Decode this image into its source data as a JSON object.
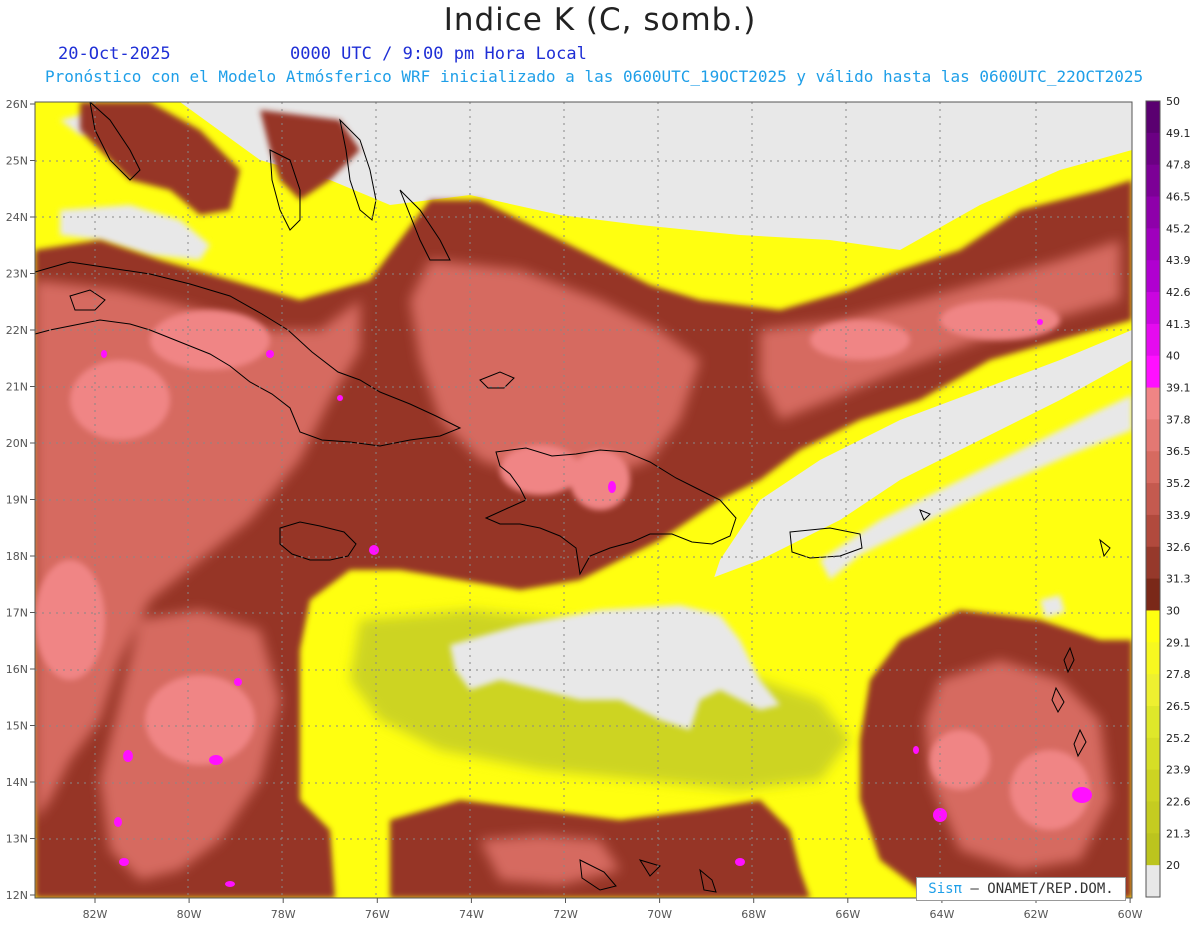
{
  "header": {
    "title": "Indice K (C, somb.)",
    "date": "20-Oct-2025",
    "time": "0000 UTC / 9:00 pm Hora Local",
    "description": "Pronóstico con el Modelo Atmósferico WRF inicializado a las 0600UTC_19OCT2025 y válido hasta las  0600UTC_22OCT2025"
  },
  "axes": {
    "lon_labels": [
      "82W",
      "80W",
      "78W",
      "76W",
      "74W",
      "72W",
      "70W",
      "68W",
      "66W",
      "64W",
      "62W",
      "60W"
    ],
    "lat_labels": [
      "26N",
      "25N",
      "24N",
      "23N",
      "22N",
      "21N",
      "20N",
      "19N",
      "18N",
      "17N",
      "16N",
      "15N",
      "14N",
      "13N",
      "12N"
    ]
  },
  "colorbar": {
    "labels": [
      "50",
      "49.1",
      "47.8",
      "46.5",
      "45.2",
      "43.9",
      "42.6",
      "41.3",
      "40",
      "39.1",
      "37.8",
      "36.5",
      "35.2",
      "33.9",
      "32.6",
      "31.3",
      "30",
      "29.1",
      "27.8",
      "26.5",
      "25.2",
      "23.9",
      "22.6",
      "21.3",
      "20"
    ],
    "colors": {
      "c50": "#5a0070",
      "c45": "#b000d0",
      "c41": "#ff10ff",
      "c39": "#f08585",
      "c36": "#d66a60",
      "c34": "#b14a3d",
      "c32": "#963426",
      "c31": "#7a2818",
      "c30": "#ffff10",
      "c28": "#eef030",
      "c26": "#dfe82a",
      "c24": "#cdd422",
      "c22": "#bcc41e",
      "c20": "#e8e8e8"
    }
  },
  "credit": {
    "logo": "Sisπ",
    "org": "– ONAMET/REP.DOM."
  }
}
